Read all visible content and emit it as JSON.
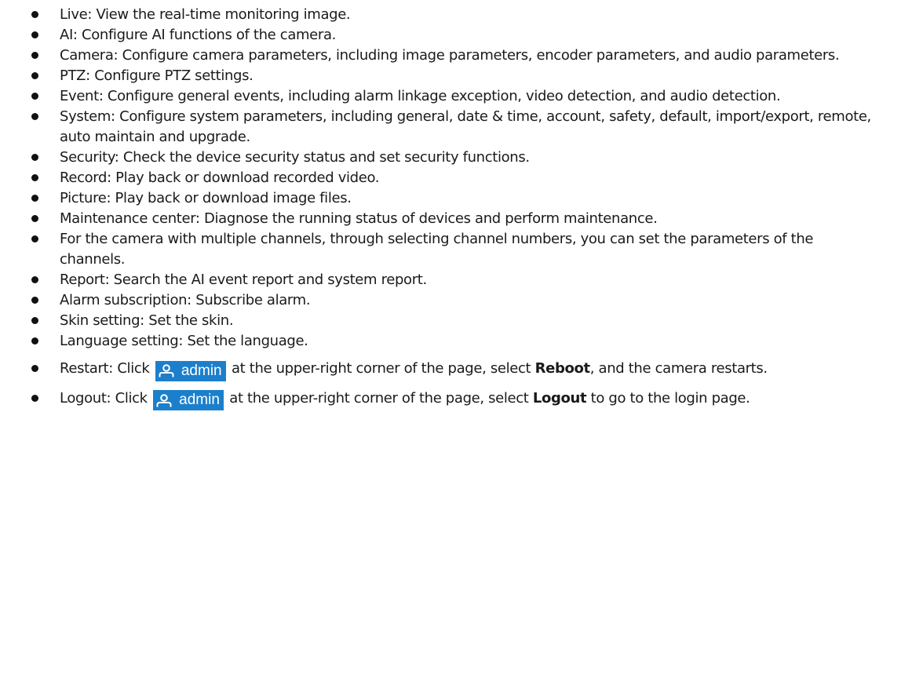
{
  "items": [
    {
      "text": "Live: View the real-time monitoring image."
    },
    {
      "text": "AI: Configure AI functions of the camera."
    },
    {
      "text": "Camera: Configure camera parameters, including image parameters, encoder parameters, and audio parameters."
    },
    {
      "text": "PTZ: Configure PTZ settings."
    },
    {
      "text": "Event: Configure general events, including alarm linkage exception, video detection, and audio detection."
    },
    {
      "text": "System: Configure system parameters, including general, date & time, account, safety, default, import/export, remote, auto maintain and upgrade."
    },
    {
      "text": "Security: Check the device security status and set security functions."
    },
    {
      "text": "Record: Play back or download recorded video."
    },
    {
      "text": "Picture: Play back or download image files."
    },
    {
      "text": "Maintenance center: Diagnose the running status of devices and perform maintenance."
    },
    {
      "text": "For the camera with multiple channels, through selecting channel numbers, you can set the parameters of the channels."
    },
    {
      "text": "Report: Search the AI event report and system report."
    },
    {
      "text": "Alarm subscription: Subscribe alarm."
    },
    {
      "text": "Skin setting: Set the skin."
    },
    {
      "text": "Language setting: Set the language."
    }
  ],
  "restart": {
    "before": "Restart: Click ",
    "after": " at the upper-right corner of the page, select ",
    "bold": "Reboot",
    "end": ", and the camera restarts."
  },
  "logout": {
    "before": "Logout: Click ",
    "after": " at the upper-right corner of the page, select ",
    "bold": "Logout",
    "end": "  to go to the login page."
  },
  "badge": {
    "label": "admin",
    "icon": "user-icon",
    "color": "#1c7fcc"
  }
}
